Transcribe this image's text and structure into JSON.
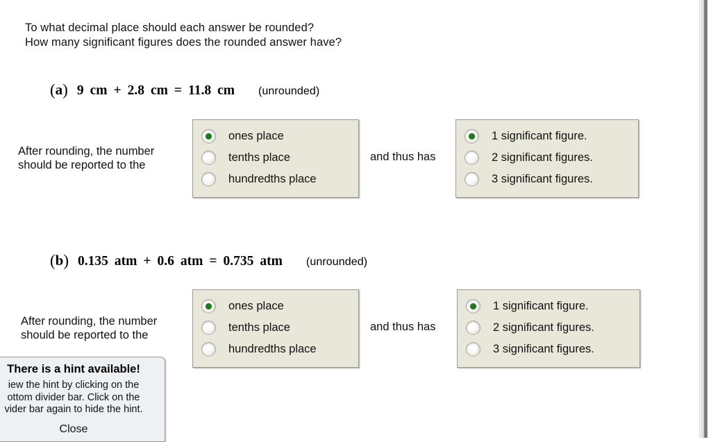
{
  "prompt": {
    "line1": "To what decimal place should each answer be rounded?",
    "line2": "How many significant figures does the rounded answer have?"
  },
  "problems": [
    {
      "label": "a",
      "open_paren": "(",
      "close_paren": ")",
      "operand1": "9",
      "unit1": "cm",
      "operator": "+",
      "operand2": "2.8",
      "unit2": "cm",
      "equals": "=",
      "result": "11.8",
      "unit3": "cm",
      "note": "(unrounded)",
      "lead_line1": "After rounding, the number",
      "lead_line2": "should be reported to the",
      "joiner": "and thus has",
      "decimal_options": [
        {
          "label": "ones place",
          "selected": true
        },
        {
          "label": "tenths place",
          "selected": false
        },
        {
          "label": "hundredths place",
          "selected": false
        }
      ],
      "sigfig_options": [
        {
          "label": "1 significant figure.",
          "selected": true
        },
        {
          "label": "2 significant figures.",
          "selected": false
        },
        {
          "label": "3 significant figures.",
          "selected": false
        }
      ]
    },
    {
      "label": "b",
      "open_paren": "(",
      "close_paren": ")",
      "operand1": "0.135",
      "unit1": "atm",
      "operator": "+",
      "operand2": "0.6",
      "unit2": "atm",
      "equals": "=",
      "result": "0.735",
      "unit3": "atm",
      "note": "(unrounded)",
      "lead_line1": "After rounding, the number",
      "lead_line2": "should be reported to the",
      "joiner": "and thus has",
      "decimal_options": [
        {
          "label": "ones place",
          "selected": true
        },
        {
          "label": "tenths place",
          "selected": false
        },
        {
          "label": "hundredths place",
          "selected": false
        }
      ],
      "sigfig_options": [
        {
          "label": "1 significant figure.",
          "selected": true
        },
        {
          "label": "2 significant figures.",
          "selected": false
        },
        {
          "label": "3 significant figures.",
          "selected": false
        }
      ]
    }
  ],
  "hint": {
    "title": "There is a hint available!",
    "body_line1": "iew the hint by clicking on the",
    "body_line2": "ottom divider bar. Click on the",
    "body_line3": "vider bar again to hide the hint.",
    "close_label": "Close"
  },
  "colors": {
    "panel_background": "#e9e7da",
    "panel_border": "#9a9a94",
    "radio_selected_dot": "#1f7a1f",
    "hint_background": "#eef1f4",
    "page_background": "#ffffff"
  }
}
